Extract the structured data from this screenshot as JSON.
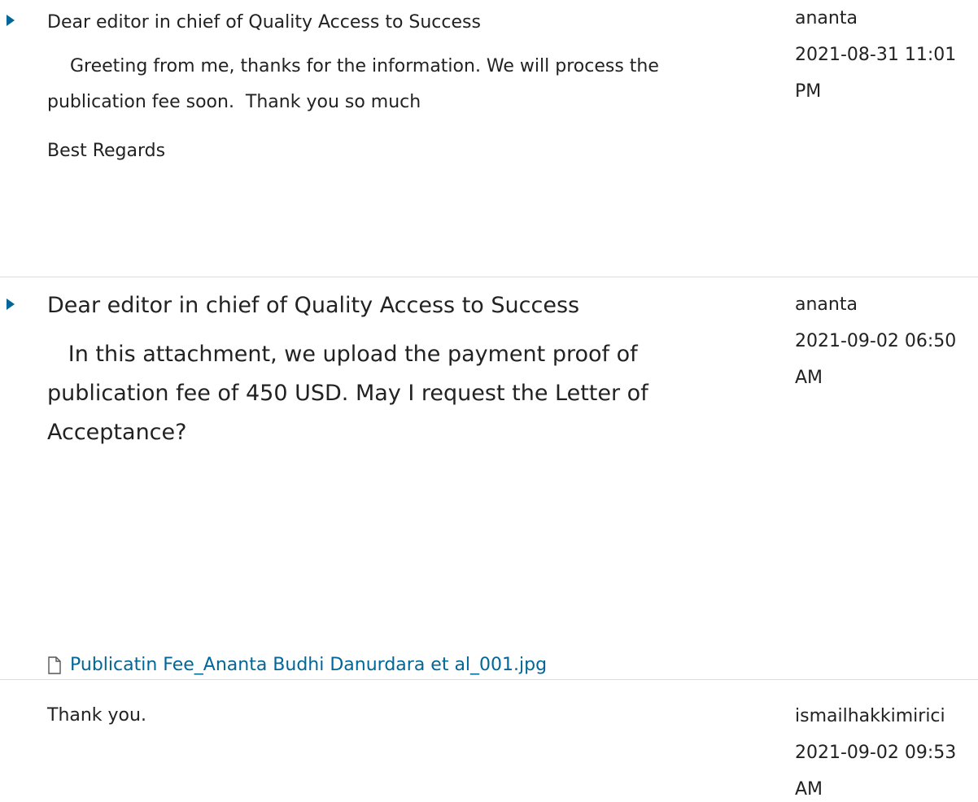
{
  "notes": [
    {
      "subject": "Dear editor in chief of Quality Access to Success",
      "message": "    Greeting from me, thanks for the information. We will process the publication fee soon.  Thank you so much",
      "closing": "Best Regards",
      "author": "ananta",
      "date": "2021-08-31 11:01",
      "meridiem": "PM"
    },
    {
      "subject": "Dear editor in chief of Quality Access to Success",
      "message": "   In this attachment, we upload the payment proof of publication fee of 450 USD. May I request the Letter of Acceptance?",
      "attachment": "Publicatin Fee_Ananta Budhi Danurdara et al_001.jpg",
      "author": "ananta",
      "date": "2021-09-02 06:50",
      "meridiem": "AM"
    },
    {
      "message": "Thank you.",
      "author": "ismailhakkimirici",
      "date": "2021-09-02 09:53",
      "meridiem": "AM"
    }
  ],
  "colors": {
    "link": "#006798",
    "toggle": "#006798",
    "divider": "#dddddd",
    "text": "#222222"
  },
  "icons": {
    "toggle": "caret-right-icon",
    "attachment": "file-icon"
  }
}
